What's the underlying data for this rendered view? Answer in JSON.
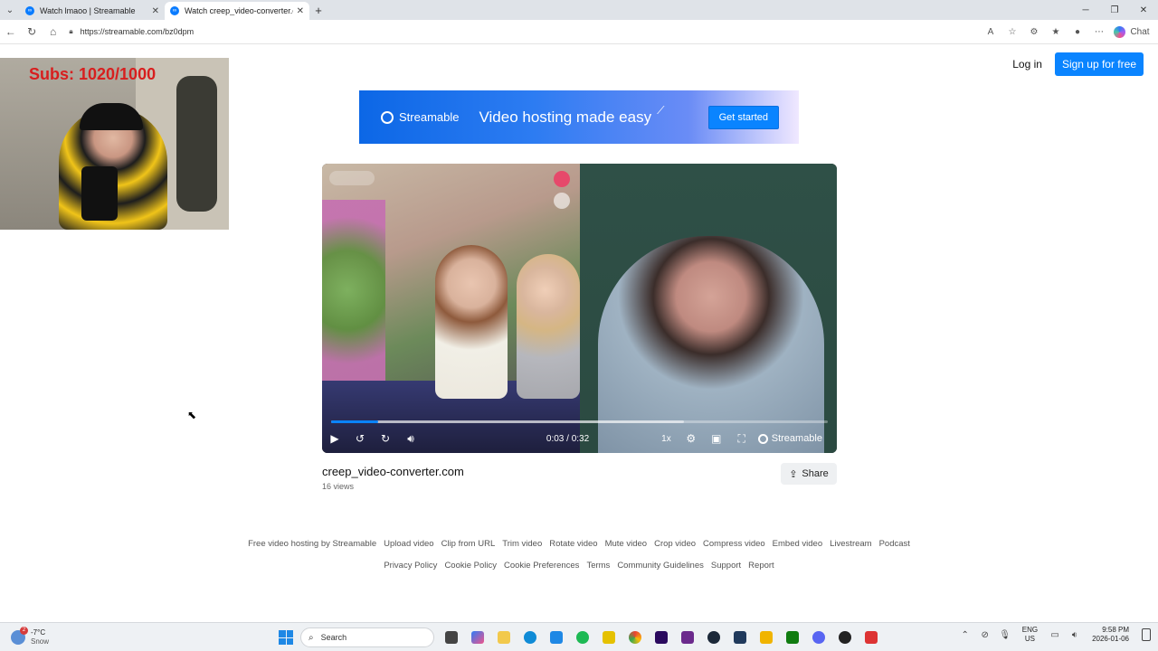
{
  "browser": {
    "tabs": [
      {
        "title": "Watch lmaoo | Streamable",
        "active": false
      },
      {
        "title": "Watch creep_video-converter.com",
        "active": true
      }
    ],
    "url": "https://streamable.com/bz0dpm",
    "chat_label": "Chat"
  },
  "header": {
    "login_label": "Log in",
    "signup_label": "Sign up for free"
  },
  "banner": {
    "brand": "Streamable",
    "tagline": "Video hosting made easy",
    "cta": "Get started",
    "accent_color": "#0a84ff"
  },
  "player": {
    "current_time": "0:03",
    "duration": "0:32",
    "time_display": "0:03 / 0:32",
    "played_fraction": 0.094,
    "buffered_fraction": 0.71,
    "speed": "1x",
    "brand": "Streamable"
  },
  "video": {
    "title": "creep_video-converter.com",
    "views": "16 views",
    "share_label": "Share"
  },
  "footer": {
    "row1": [
      "Free video hosting by Streamable",
      "Upload video",
      "Clip from URL",
      "Trim video",
      "Rotate video",
      "Mute video",
      "Crop video",
      "Compress video",
      "Embed video",
      "Livestream",
      "Podcast"
    ],
    "row2": [
      "Privacy Policy",
      "Cookie Policy",
      "Cookie Preferences",
      "Terms",
      "Community Guidelines",
      "Support",
      "Report"
    ]
  },
  "webcam_overlay": {
    "subs_text": "Subs: 1020/1000"
  },
  "taskbar": {
    "temperature": "-7°C",
    "condition": "Snow",
    "weather_badge": "2",
    "search_placeholder": "Search",
    "lang_top": "ENG",
    "lang_bottom": "US",
    "time": "9:58 PM",
    "date": "2026-01-06"
  }
}
